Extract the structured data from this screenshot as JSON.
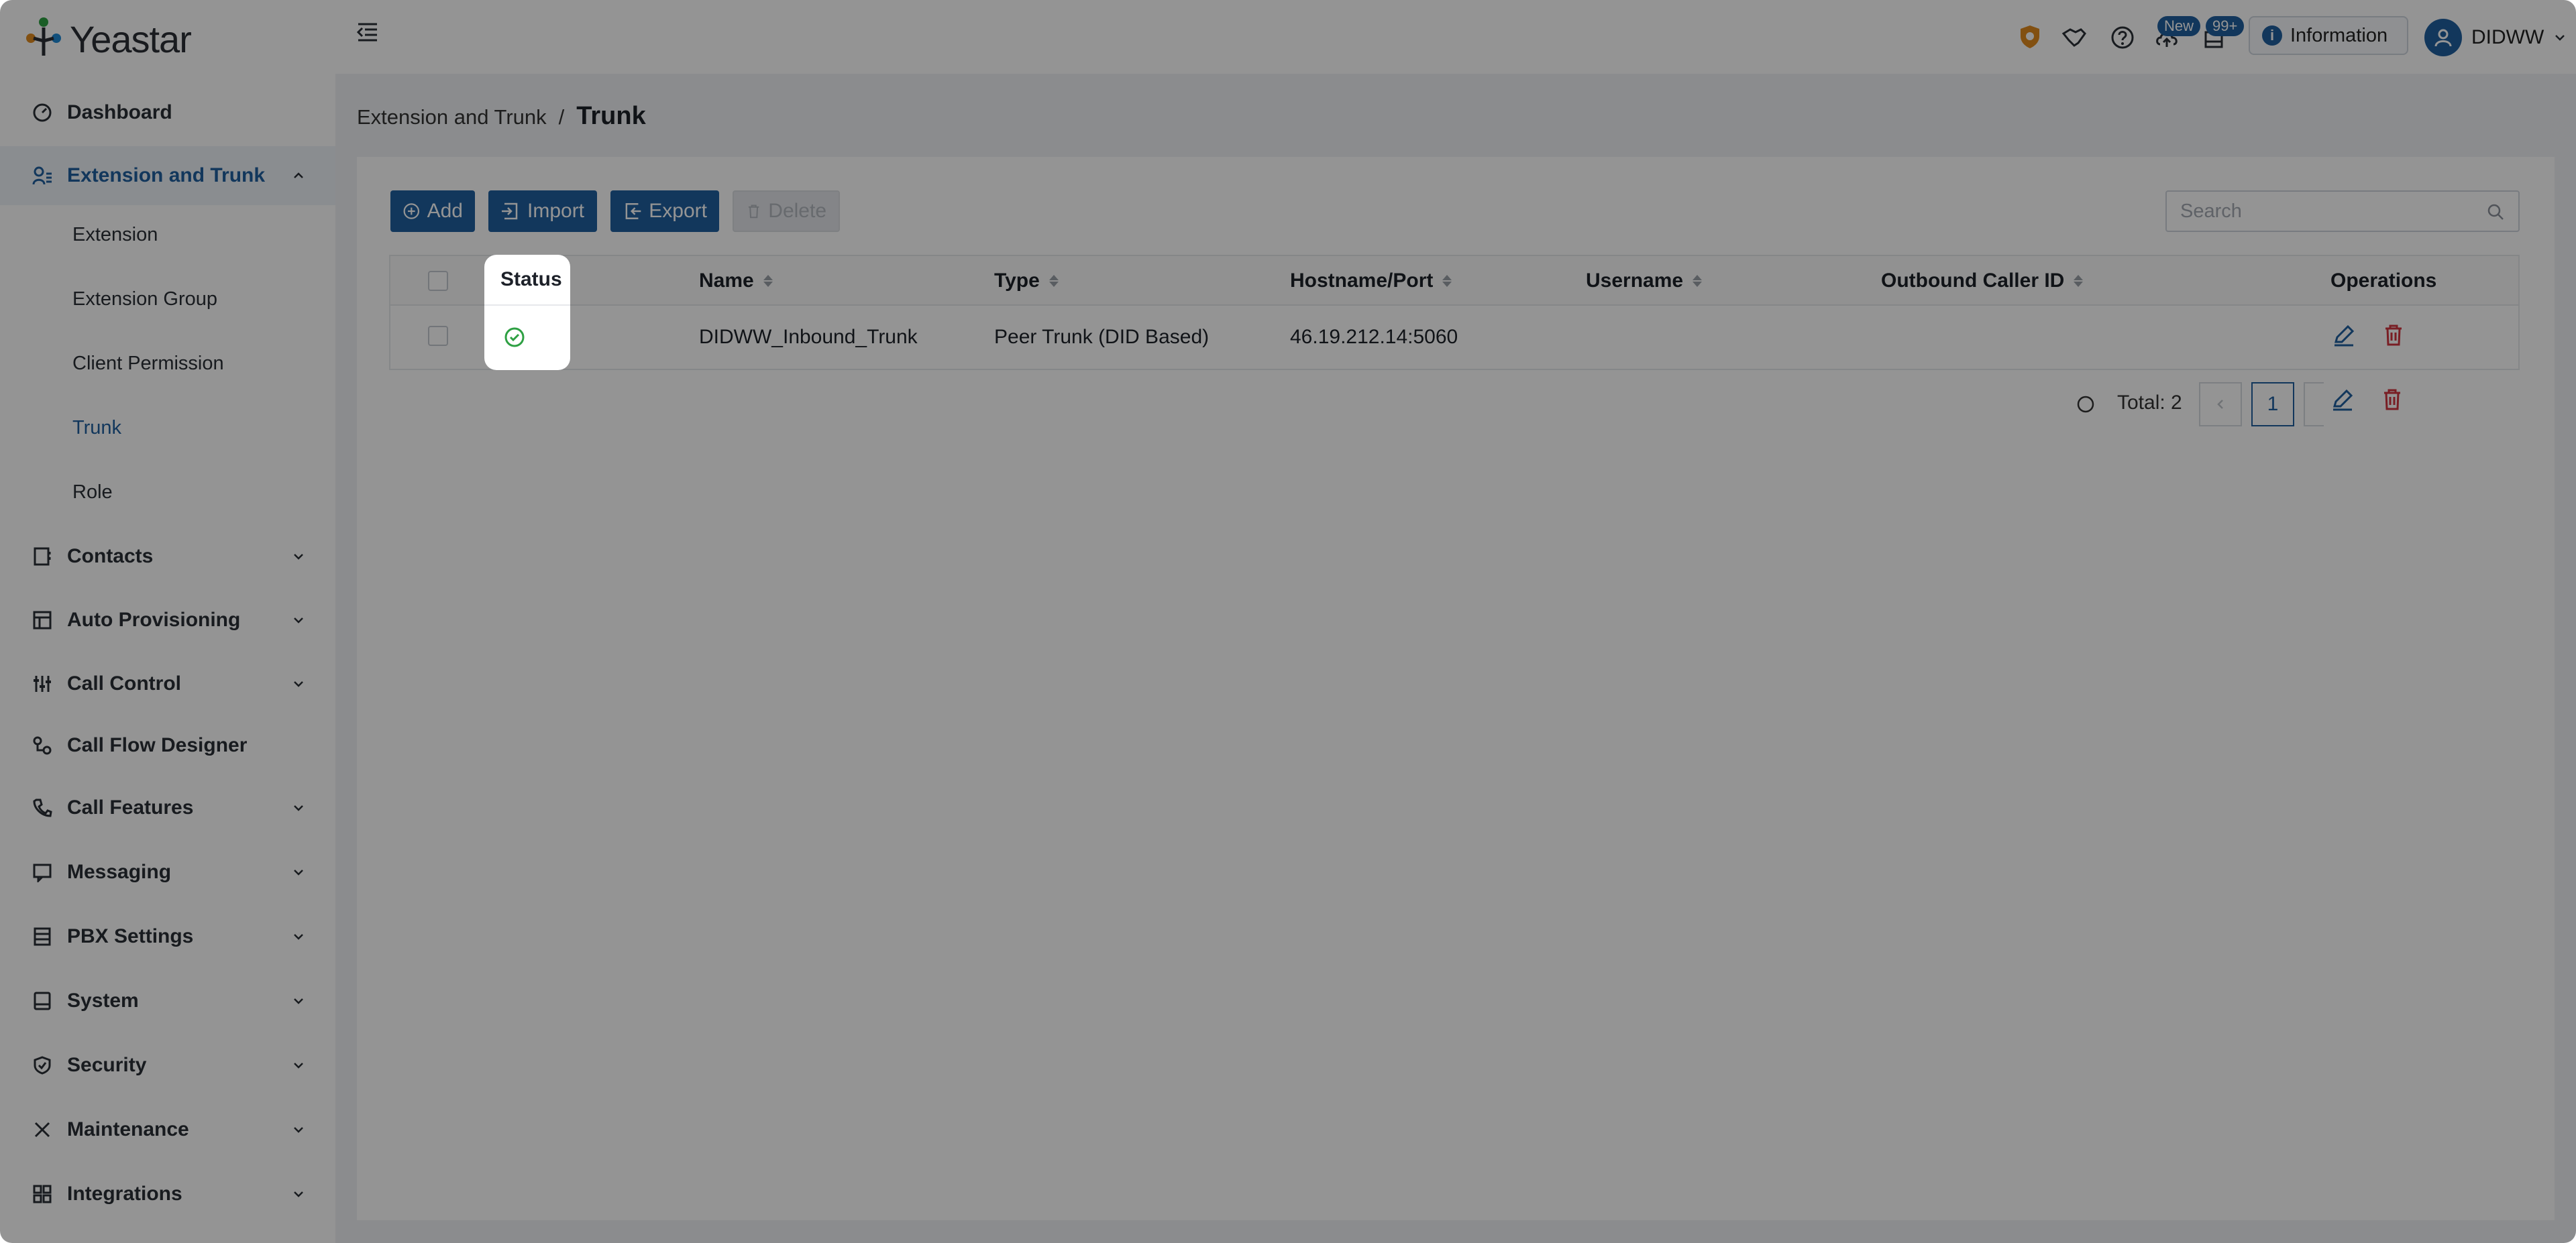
{
  "app": {
    "brand": "Yeastar"
  },
  "colors": {
    "accent": "#1f5f9f",
    "danger": "#d0343f",
    "success": "#2ea043",
    "warning": "#e08a1e"
  },
  "sidebar": {
    "items": [
      {
        "label": "Dashboard",
        "icon": "dashboard-icon"
      },
      {
        "label": "Extension and Trunk",
        "icon": "user-list-icon",
        "expanded": true,
        "children": [
          {
            "label": "Extension"
          },
          {
            "label": "Extension Group"
          },
          {
            "label": "Client Permission"
          },
          {
            "label": "Trunk",
            "active": true
          },
          {
            "label": "Role"
          }
        ]
      },
      {
        "label": "Contacts",
        "icon": "contacts-icon"
      },
      {
        "label": "Auto Provisioning",
        "icon": "provisioning-icon"
      },
      {
        "label": "Call Control",
        "icon": "sliders-icon"
      },
      {
        "label": "Call Flow Designer",
        "icon": "flow-icon"
      },
      {
        "label": "Call Features",
        "icon": "phone-icon"
      },
      {
        "label": "Messaging",
        "icon": "message-icon"
      },
      {
        "label": "PBX Settings",
        "icon": "settings-list-icon"
      },
      {
        "label": "System",
        "icon": "system-icon"
      },
      {
        "label": "Security",
        "icon": "shield-icon"
      },
      {
        "label": "Maintenance",
        "icon": "tools-icon"
      },
      {
        "label": "Integrations",
        "icon": "integrations-icon"
      }
    ]
  },
  "topbar": {
    "badge_new": "New",
    "badge_count": "99+",
    "info_label": "Information",
    "user_name": "DIDWW"
  },
  "breadcrumb": {
    "parent": "Extension and Trunk",
    "separator": "/",
    "current": "Trunk"
  },
  "toolbar": {
    "add_label": "Add",
    "import_label": "Import",
    "export_label": "Export",
    "delete_label": "Delete",
    "search_placeholder": "Search"
  },
  "table": {
    "columns": [
      "Status",
      "Name",
      "Type",
      "Hostname/Port",
      "Username",
      "Outbound Caller ID",
      "Operations"
    ],
    "rows": [
      {
        "status": "ok",
        "name": "DIDWW_Inbound_Trunk",
        "type": "Peer Trunk (DID Based)",
        "hostname": "46.19.212.14:5060",
        "username": "",
        "caller_id": ""
      }
    ]
  },
  "pagination": {
    "total": "Total: 2",
    "page": "1"
  }
}
